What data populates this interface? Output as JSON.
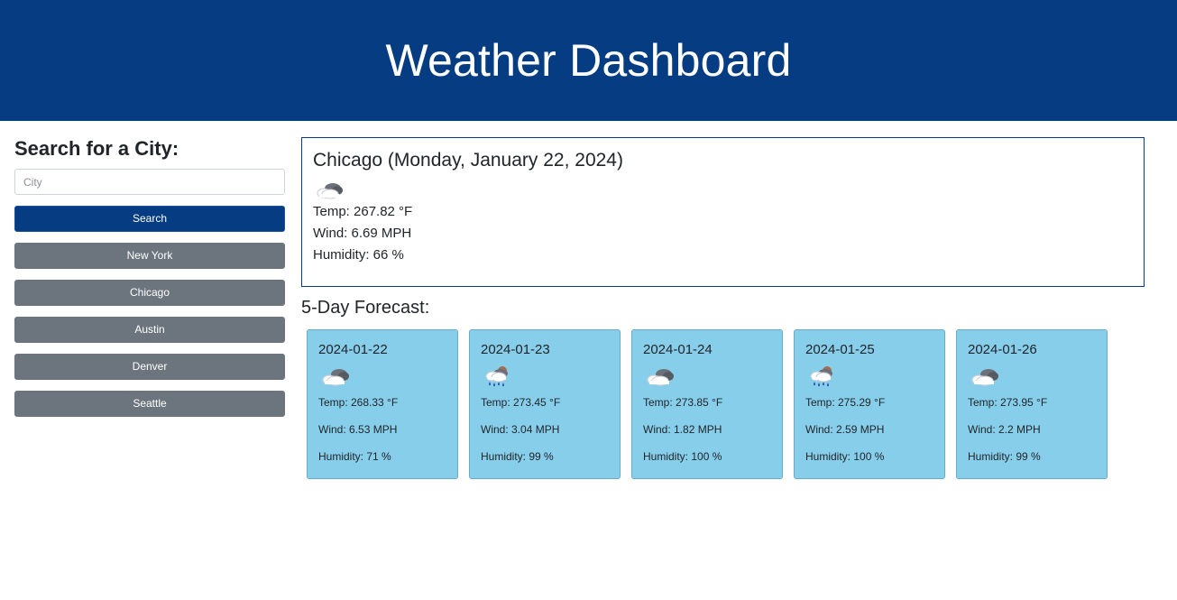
{
  "header": {
    "title": "Weather Dashboard"
  },
  "search": {
    "heading": "Search for a City:",
    "placeholder": "City",
    "button_label": "Search"
  },
  "history": [
    {
      "label": "New York"
    },
    {
      "label": "Chicago"
    },
    {
      "label": "Austin"
    },
    {
      "label": "Denver"
    },
    {
      "label": "Seattle"
    }
  ],
  "current": {
    "title": "Chicago (Monday, January 22, 2024)",
    "icon": "cloudy-night-icon",
    "temp": "Temp: 267.82 °F",
    "wind": "Wind: 6.69 MPH",
    "humidity": "Humidity: 66 %"
  },
  "forecast": {
    "title": "5-Day Forecast:",
    "days": [
      {
        "date": "2024-01-22",
        "icon": "cloudy-icon",
        "temp": "Temp: 268.33 °F",
        "wind": "Wind: 6.53 MPH",
        "humidity": "Humidity: 71 %"
      },
      {
        "date": "2024-01-23",
        "icon": "rain-icon",
        "temp": "Temp: 273.45 °F",
        "wind": "Wind: 3.04 MPH",
        "humidity": "Humidity: 99 %"
      },
      {
        "date": "2024-01-24",
        "icon": "cloudy-icon",
        "temp": "Temp: 273.85 °F",
        "wind": "Wind: 1.82 MPH",
        "humidity": "Humidity: 100 %"
      },
      {
        "date": "2024-01-25",
        "icon": "rain-icon",
        "temp": "Temp: 275.29 °F",
        "wind": "Wind: 2.59 MPH",
        "humidity": "Humidity: 100 %"
      },
      {
        "date": "2024-01-26",
        "icon": "cloudy-icon",
        "temp": "Temp: 273.95 °F",
        "wind": "Wind: 2.2 MPH",
        "humidity": "Humidity: 99 %"
      }
    ]
  },
  "colors": {
    "header_bg": "#063d82",
    "search_button": "#063d82",
    "history_button": "#6c757d",
    "forecast_card": "#87ceeb"
  }
}
